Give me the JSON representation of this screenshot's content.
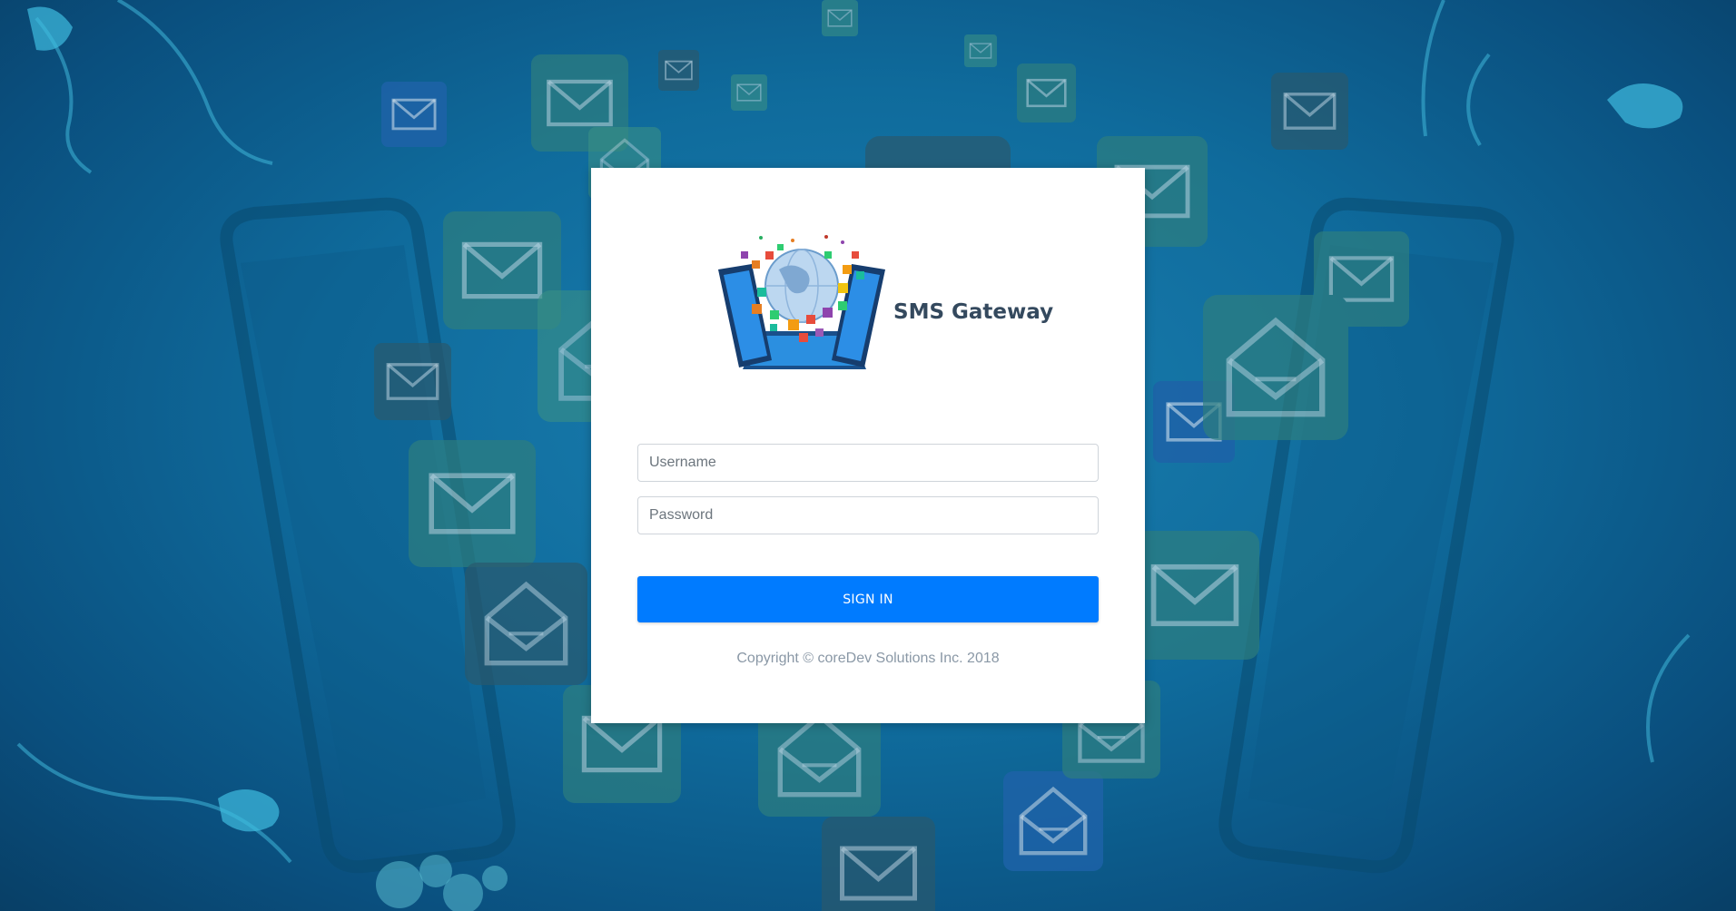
{
  "app": {
    "title": "SMS Gateway"
  },
  "login": {
    "username_placeholder": "Username",
    "password_placeholder": "Password",
    "signin_label": "SIGN IN"
  },
  "footer": {
    "copyright": "Copyright © coreDev Solutions Inc. 2018"
  },
  "colors": {
    "primary": "#007bff",
    "background": "#0f6b9c",
    "title": "#34495e"
  },
  "icons": {
    "logo": "globe-phones-messages-logo",
    "background": "envelope-icons-phones-background"
  }
}
